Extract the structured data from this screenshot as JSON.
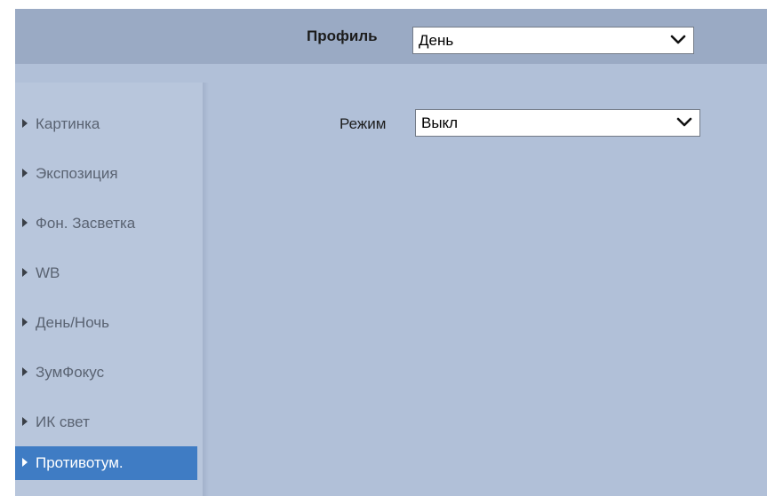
{
  "header": {
    "profile_label": "Профиль",
    "profile_value": "День"
  },
  "sidebar": {
    "items": [
      {
        "label": "Картинка"
      },
      {
        "label": "Экспозиция"
      },
      {
        "label": "Фон. Засветка"
      },
      {
        "label": "WB"
      },
      {
        "label": "День/Ночь"
      },
      {
        "label": "ЗумФокус"
      },
      {
        "label": "ИК свет"
      },
      {
        "label": "Противотум."
      }
    ],
    "active_index": 7
  },
  "main": {
    "mode_label": "Режим",
    "mode_value": "Выкл"
  },
  "colors": {
    "panel": "#b1c0d8",
    "topbar": "#9aaac4",
    "sidebar": "#b8c6dc",
    "active": "#3f7cc4"
  },
  "icons": {
    "nav_arrow": "triangle-right-icon",
    "select_arrow": "chevron-down-icon"
  }
}
